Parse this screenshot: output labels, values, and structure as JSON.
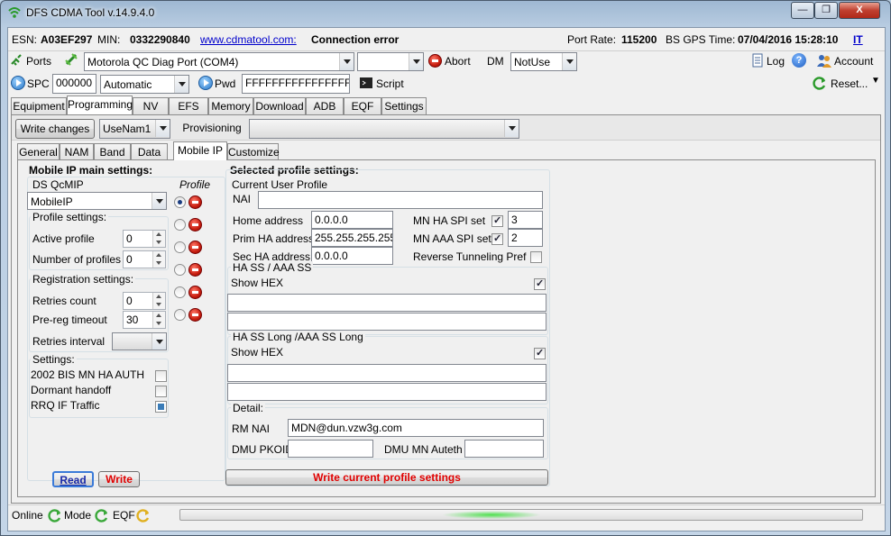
{
  "window": {
    "title": "DFS CDMA Tool v.14.9.4.0",
    "minimize": "—",
    "maximize": "❐",
    "close": "X"
  },
  "infobar": {
    "esn_label": "ESN:",
    "esn": "A03EF297",
    "min_label": "MIN:",
    "min": "0332290840",
    "site": "www.cdmatool.com:",
    "status": "Connection error",
    "port_rate_label": "Port Rate:",
    "port_rate": "115200",
    "gps_label": "BS GPS Time:",
    "gps_time": "07/04/2016 15:28:10",
    "it": "IT"
  },
  "toolbar1": {
    "ports": "Ports",
    "port_select": "Motorola QC Diag Port (COM4)",
    "abort": "Abort",
    "dm_label": "DM",
    "dm_value": "NotUse",
    "log": "Log",
    "help": "?",
    "account": "Account"
  },
  "toolbar2": {
    "spc_label": "SPC",
    "spc_value": "000000",
    "spc_mode": "Automatic",
    "pwd_label": "Pwd",
    "pwd_value": "FFFFFFFFFFFFFFFF",
    "script": "Script",
    "reset": "Reset..."
  },
  "main_tabs": [
    "Equipment",
    "Programming",
    "NV",
    "EFS",
    "Memory",
    "Download",
    "ADB",
    "EQF",
    "Settings"
  ],
  "prog": {
    "write_changes": "Write changes",
    "user": "UseNam1",
    "provisioning": "Provisioning",
    "provisioning_value": ""
  },
  "sub_tabs": [
    "General",
    "NAM",
    "Band",
    "Data",
    "Mobile IP",
    "Customize"
  ],
  "left": {
    "title": "Mobile IP main settings:",
    "ds_qcmip": "DS QcMIP",
    "ds_value": "MobileIP",
    "profile_col": "Profile",
    "profile_settings": "Profile settings:",
    "active_profile": "Active profile",
    "active_profile_value": "0",
    "num_profiles": "Number of profiles",
    "num_profiles_value": "0",
    "registration": "Registration settings:",
    "retries_count": "Retries count",
    "retries_count_value": "0",
    "prereg": "Pre-reg timeout",
    "prereg_value": "30",
    "retries_interval": "Retries interval",
    "retries_interval_value": "",
    "settings": "Settings:",
    "bis": "2002 BIS MN HA AUTH",
    "dormant": "Dormant handoff",
    "rrq": "RRQ IF Traffic",
    "read": "Read",
    "write": "Write"
  },
  "right": {
    "title": "Selected profile settings:",
    "current_user": "Current User Profile",
    "nai_label": "NAI",
    "nai_value": "",
    "home_label": "Home address",
    "home_value": "0.0.0.0",
    "prim_label": "Prim HA address",
    "prim_value": "255.255.255.255",
    "sec_label": "Sec HA address",
    "sec_value": "0.0.0.0",
    "mn_ha_label": "MN HA SPI set",
    "mn_ha_value": "3",
    "mn_aaa_label": "MN AAA SPI set",
    "mn_aaa_value": "2",
    "reverse": "Reverse Tunneling Pref",
    "ha_ss": "HA SS / AAA SS",
    "show_hex": "Show HEX",
    "ha_ss_long": "HA SS Long /AAA SS Long",
    "show_hex2": "Show HEX",
    "detail": "Detail:",
    "rm_nai_label": "RM NAI",
    "rm_nai_value": "MDN@dun.vzw3g.com",
    "dmu_pkoid": "DMU PKOID",
    "dmu_mn": "DMU MN Auteth",
    "write_profile": "Write current profile settings"
  },
  "statusbar": {
    "online": "Online",
    "mode": "Mode",
    "eqf": "EQF"
  }
}
